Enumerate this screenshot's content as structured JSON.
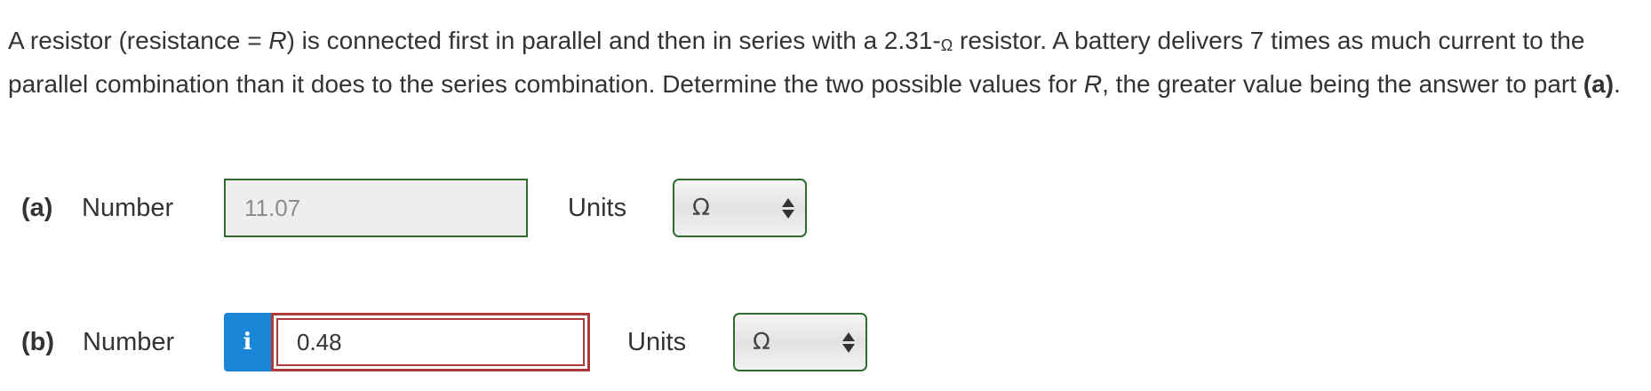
{
  "question": {
    "text_1": "A resistor (resistance = ",
    "var_r": "R",
    "text_2": ") is connected first in parallel and then in series with a 2.31-",
    "ohm_symbol": "Ω",
    "text_3": " resistor. A battery delivers 7 times as much current to the parallel combination than it does to the series combination. Determine the two possible values for ",
    "var_r2": "R",
    "text_4": ", the greater value being the answer to part ",
    "part_ref": "(a)",
    "text_5": "."
  },
  "part_a": {
    "label": "(a)",
    "number_label": "Number",
    "value": "11.07",
    "status": "correct",
    "units_label": "Units",
    "units_value": "Ω"
  },
  "part_b": {
    "label": "(b)",
    "number_label": "Number",
    "info_icon": "i",
    "value": "0.48",
    "status": "incorrect",
    "units_label": "Units",
    "units_value": "Ω"
  },
  "colors": {
    "correct_border": "#2e6b2e",
    "incorrect_border": "#b03a3a",
    "info_button": "#1a86d8",
    "text": "#333333"
  },
  "icons": {
    "info": "info-icon",
    "select_arrows": "up-down-arrows-icon"
  }
}
